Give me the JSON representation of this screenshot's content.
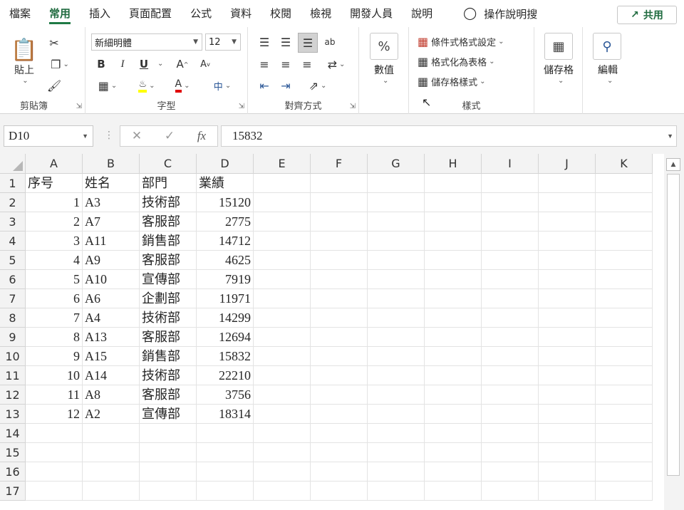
{
  "tabs": [
    "檔案",
    "常用",
    "插入",
    "頁面配置",
    "公式",
    "資料",
    "校閱",
    "檢視",
    "開發人員",
    "說明"
  ],
  "tell_me": "操作說明搜",
  "share_label": "共用",
  "clipboard": {
    "paste": "貼上",
    "group": "剪貼簿"
  },
  "font": {
    "name": "新細明體",
    "size": "12",
    "group": "字型",
    "bold": "B",
    "italic": "I",
    "underline": "U",
    "grow": "A",
    "shrink": "A",
    "phonetic": "中",
    "font_color_letter": "A"
  },
  "align": {
    "group": "對齊方式"
  },
  "number": {
    "label": "數值",
    "symbol": "%"
  },
  "styles": {
    "cond": "條件式格式設定",
    "table": "格式化為表格",
    "cellstyle": "儲存格樣式",
    "group": "樣式"
  },
  "cells": {
    "label": "儲存格"
  },
  "editing": {
    "label": "編輯"
  },
  "formula_bar": {
    "name_box": "D10",
    "content": "15832"
  },
  "columns": [
    "A",
    "B",
    "C",
    "D",
    "E",
    "F",
    "G",
    "H",
    "I",
    "J",
    "K"
  ],
  "row_numbers": [
    "1",
    "2",
    "3",
    "4",
    "5",
    "6",
    "7",
    "8",
    "9",
    "10",
    "11",
    "12",
    "13",
    "14",
    "15",
    "16",
    "17"
  ],
  "rows": [
    [
      "序号",
      "姓名",
      "部門",
      "業績"
    ],
    [
      "1",
      "A3",
      "技術部",
      "15120"
    ],
    [
      "2",
      "A7",
      "客服部",
      "2775"
    ],
    [
      "3",
      "A11",
      "銷售部",
      "14712"
    ],
    [
      "4",
      "A9",
      "客服部",
      "4625"
    ],
    [
      "5",
      "A10",
      "宣傳部",
      "7919"
    ],
    [
      "6",
      "A6",
      "企劃部",
      "11971"
    ],
    [
      "7",
      "A4",
      "技術部",
      "14299"
    ],
    [
      "8",
      "A13",
      "客服部",
      "12694"
    ],
    [
      "9",
      "A15",
      "銷售部",
      "15832"
    ],
    [
      "10",
      "A14",
      "技術部",
      "22210"
    ],
    [
      "11",
      "A8",
      "客服部",
      "3756"
    ],
    [
      "12",
      "A2",
      "宣傳部",
      "18314"
    ]
  ],
  "colors": {
    "accent": "#1f7a45",
    "highlight": "#ffff00",
    "font_color": "#e00000"
  }
}
